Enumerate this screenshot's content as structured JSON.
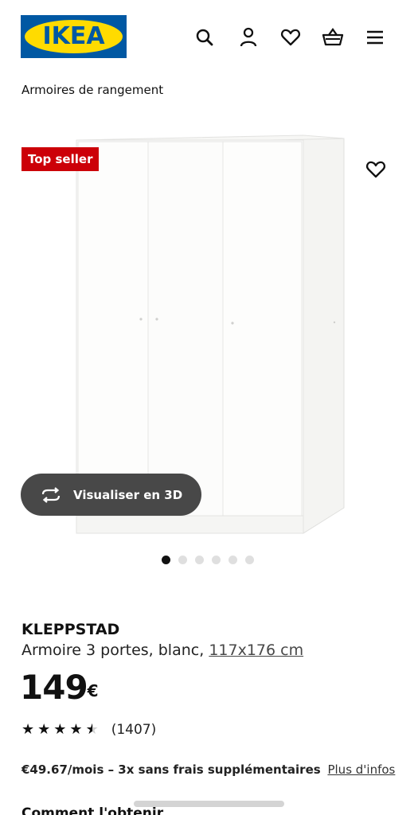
{
  "header": {
    "logo_text": "IKEA",
    "icons": [
      "search-icon",
      "user-icon",
      "heart-icon",
      "basket-icon",
      "menu-icon"
    ]
  },
  "breadcrumb": "Armoires de rangement",
  "hero": {
    "badge": "Top seller",
    "view_3d_label": "Visualiser en 3D",
    "image_count": 6,
    "active_image": 1
  },
  "product": {
    "name": "KLEPPSTAD",
    "description": "Armoire 3 portes, blanc,",
    "dimensions": "117x176 cm",
    "price": "149",
    "currency": "€",
    "rating": 4.5,
    "rating_max": 5,
    "review_count": "(1407)"
  },
  "finance": {
    "text": "€49.67/mois – 3x sans frais supplémentaires",
    "link": "Plus d'infos"
  },
  "next_section": "Comment l'obtenir",
  "colors": {
    "ikea_blue": "#0058a3",
    "ikea_yellow": "#ffdb00",
    "badge_red": "#cc0008",
    "button_dark": "#484848"
  }
}
